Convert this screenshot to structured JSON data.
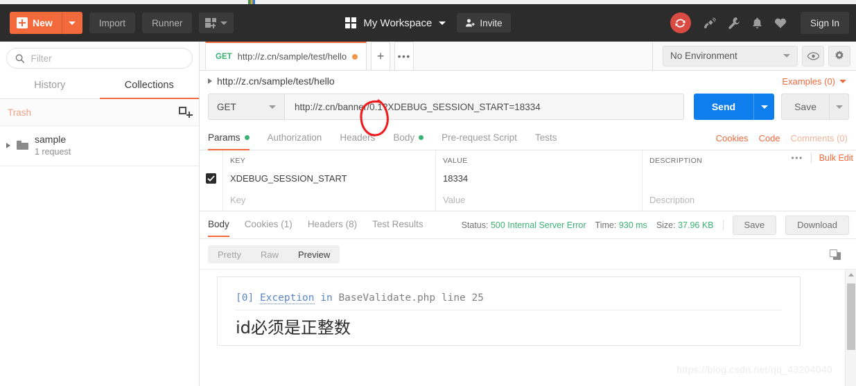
{
  "header": {
    "new_button": "New",
    "import_button": "Import",
    "runner_button": "Runner",
    "workspace_name": "My Workspace",
    "invite_button": "Invite",
    "sign_in_button": "Sign In",
    "icons": [
      "panel-new-icon",
      "grid-icon",
      "invite-user-icon",
      "sync-icon",
      "satellite-icon",
      "wrench-icon",
      "bell-icon",
      "heart-icon"
    ],
    "accent_color": "#f2693c",
    "sync_color": "#d94b42",
    "bg_color": "#2c2c2c"
  },
  "sidebar": {
    "filter_placeholder": "Filter",
    "tabs": [
      {
        "label": "History",
        "active": false
      },
      {
        "label": "Collections",
        "active": true
      }
    ],
    "trash_label": "Trash",
    "collection": {
      "name": "sample",
      "meta": "1 request"
    }
  },
  "request_tab": {
    "method": "GET",
    "url": "http://z.cn/sample/test/hello",
    "unsaved": true,
    "add_tab_label": "+",
    "more_label": "•••"
  },
  "environment": {
    "selected": "No Environment",
    "eye_icon": "eye-icon",
    "gear_icon": "gear-icon"
  },
  "breadcrumb": {
    "path": "http://z.cn/sample/test/hello",
    "examples": "Examples (0)"
  },
  "url_bar": {
    "method": "GET",
    "url": "http://z.cn/banner/0.1?XDEBUG_SESSION_START=18334",
    "send_label": "Send",
    "save_label": "Save"
  },
  "request_tabs": {
    "items": [
      {
        "label": "Params",
        "active": true,
        "dot": true
      },
      {
        "label": "Authorization",
        "active": false,
        "dot": false
      },
      {
        "label": "Headers",
        "active": false,
        "dot": false
      },
      {
        "label": "Body",
        "active": false,
        "dot": true
      },
      {
        "label": "Pre-request Script",
        "active": false,
        "dot": false
      },
      {
        "label": "Tests",
        "active": false,
        "dot": false
      }
    ],
    "cookies_link": "Cookies",
    "code_link": "Code",
    "comments_link": "Comments (0)"
  },
  "params_table": {
    "headers": {
      "key": "KEY",
      "value": "VALUE",
      "description": "DESCRIPTION"
    },
    "bulk_edit": "Bulk Edit",
    "rows": [
      {
        "checked": true,
        "key": "XDEBUG_SESSION_START",
        "value": "18334",
        "description": ""
      }
    ],
    "placeholder_row": {
      "key": "Key",
      "value": "Value",
      "description": "Description"
    }
  },
  "response": {
    "tabs": [
      {
        "label": "Body",
        "active": true
      },
      {
        "label": "Cookies (1)",
        "active": false
      },
      {
        "label": "Headers (8)",
        "active": false
      },
      {
        "label": "Test Results",
        "active": false
      }
    ],
    "status_label": "Status:",
    "status_value": "500 Internal Server Error",
    "time_label": "Time:",
    "time_value": "930 ms",
    "size_label": "Size:",
    "size_value": "37.96 KB",
    "save_button": "Save",
    "download_button": "Download",
    "view_modes": [
      {
        "label": "Pretty",
        "active": false
      },
      {
        "label": "Raw",
        "active": false
      },
      {
        "label": "Preview",
        "active": true
      }
    ],
    "copy_icon": "copy-icon",
    "body": {
      "error_index": "[0]",
      "error_type": "Exception",
      "error_in": "in",
      "error_file": "BaseValidate.php line 25",
      "error_message": "id必须是正整数"
    }
  },
  "watermark": "https://blog.csdn.net/qq_43204040",
  "annotation": {
    "type": "red-circle",
    "color": "#ee1c1c"
  }
}
